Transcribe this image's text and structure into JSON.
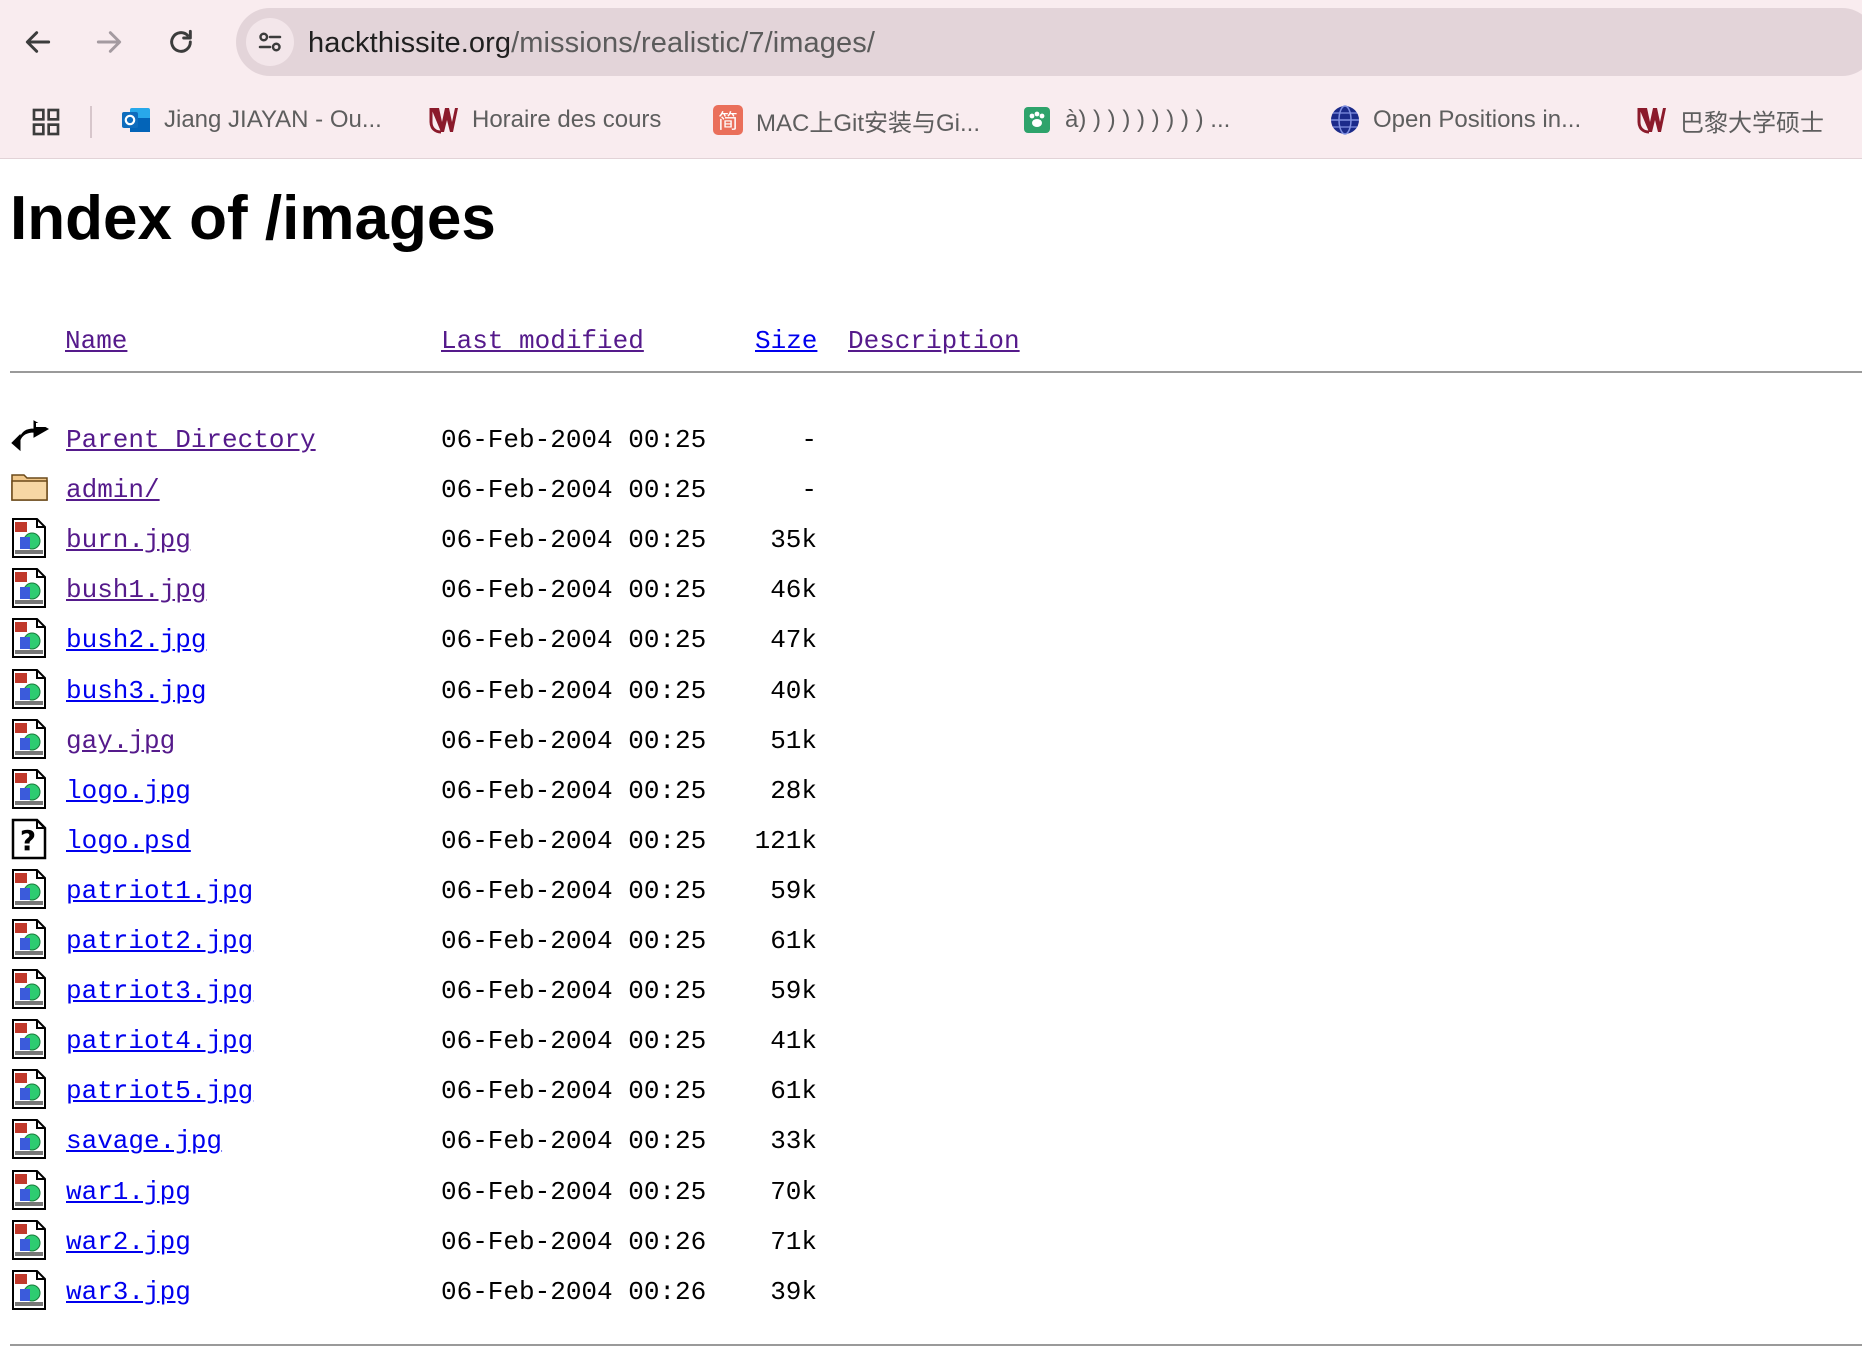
{
  "browser": {
    "url_host": "hackthissite.org",
    "url_path": "/missions/realistic/7/images/",
    "bookmarks": [
      {
        "label": "Jiang JIAYAN - Ou...",
        "icon": "outlook-icon"
      },
      {
        "label": "Horaire des cours",
        "icon": "university-logo-icon"
      },
      {
        "label": "MAC上Git安装与Gi...",
        "icon": "jianshu-icon"
      },
      {
        "label": "à) ) ) ) ) ) ) ) ) ...",
        "icon": "paw-icon"
      },
      {
        "label": "Open Positions in...",
        "icon": "globe-icon"
      },
      {
        "label": "巴黎大学硕士",
        "icon": "university-logo-icon"
      }
    ]
  },
  "page": {
    "title": "Index of /images",
    "headers": {
      "name": "Name",
      "last_modified": "Last modified",
      "size": "Size",
      "description": "Description"
    },
    "files": [
      {
        "name": "Parent Directory",
        "modified": "06-Feb-2004 00:25",
        "size": "-",
        "icon": "back-arrow-icon",
        "visited": true
      },
      {
        "name": "admin/",
        "modified": "06-Feb-2004 00:25",
        "size": "-",
        "icon": "folder-icon",
        "visited": true
      },
      {
        "name": "burn.jpg",
        "modified": "06-Feb-2004 00:25",
        "size": "35k",
        "icon": "image-file-icon",
        "visited": true
      },
      {
        "name": "bush1.jpg",
        "modified": "06-Feb-2004 00:25",
        "size": "46k",
        "icon": "image-file-icon",
        "visited": true
      },
      {
        "name": "bush2.jpg",
        "modified": "06-Feb-2004 00:25",
        "size": "47k",
        "icon": "image-file-icon",
        "visited": false
      },
      {
        "name": "bush3.jpg",
        "modified": "06-Feb-2004 00:25",
        "size": "40k",
        "icon": "image-file-icon",
        "visited": false
      },
      {
        "name": "gay.jpg",
        "modified": "06-Feb-2004 00:25",
        "size": "51k",
        "icon": "image-file-icon",
        "visited": true
      },
      {
        "name": "logo.jpg",
        "modified": "06-Feb-2004 00:25",
        "size": "28k",
        "icon": "image-file-icon",
        "visited": false
      },
      {
        "name": "logo.psd",
        "modified": "06-Feb-2004 00:25",
        "size": "121k",
        "icon": "unknown-file-icon",
        "visited": false
      },
      {
        "name": "patriot1.jpg",
        "modified": "06-Feb-2004 00:25",
        "size": "59k",
        "icon": "image-file-icon",
        "visited": false
      },
      {
        "name": "patriot2.jpg",
        "modified": "06-Feb-2004 00:25",
        "size": "61k",
        "icon": "image-file-icon",
        "visited": false
      },
      {
        "name": "patriot3.jpg",
        "modified": "06-Feb-2004 00:25",
        "size": "59k",
        "icon": "image-file-icon",
        "visited": false
      },
      {
        "name": "patriot4.jpg",
        "modified": "06-Feb-2004 00:25",
        "size": "41k",
        "icon": "image-file-icon",
        "visited": false
      },
      {
        "name": "patriot5.jpg",
        "modified": "06-Feb-2004 00:25",
        "size": "61k",
        "icon": "image-file-icon",
        "visited": false
      },
      {
        "name": "savage.jpg",
        "modified": "06-Feb-2004 00:25",
        "size": "33k",
        "icon": "image-file-icon",
        "visited": false
      },
      {
        "name": "war1.jpg",
        "modified": "06-Feb-2004 00:25",
        "size": "70k",
        "icon": "image-file-icon",
        "visited": false
      },
      {
        "name": "war2.jpg",
        "modified": "06-Feb-2004 00:26",
        "size": "71k",
        "icon": "image-file-icon",
        "visited": false
      },
      {
        "name": "war3.jpg",
        "modified": "06-Feb-2004 00:26",
        "size": "39k",
        "icon": "image-file-icon",
        "visited": false
      }
    ]
  },
  "colors": {
    "link": "#0000ee",
    "visited_link": "#551a8b",
    "chrome_bg": "#f9ecef",
    "omnibox_bg": "#e3d4d9"
  }
}
